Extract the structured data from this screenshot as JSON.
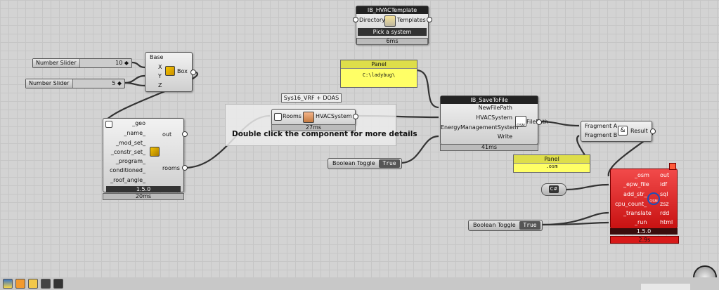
{
  "hvac_template": {
    "title": "IB_HVACTemplate",
    "in_directory": "Directory",
    "out_templates": "Templates",
    "pick": "Pick a system",
    "time": "6ms"
  },
  "panel1": {
    "title": "Panel",
    "text": "C:\\ladybug\\"
  },
  "slider1": {
    "name": "Number Slider",
    "value": "10 ◆"
  },
  "slider2": {
    "name": "Number Slider",
    "value": "5 ◆"
  },
  "box": {
    "base": "Base",
    "x": "X",
    "y": "Y",
    "z": "Z",
    "out": "Box"
  },
  "group": {
    "title": "Sys16_VRF + DOAS",
    "note": "Double click the component for more details",
    "in_rooms": "Rooms",
    "out_hvac": "HVACSystem",
    "time": "27ms"
  },
  "room": {
    "inputs": [
      "_geo",
      "_name_",
      "_mod_set_",
      "_constr_set_",
      "_program_",
      "conditioned_",
      "_roof_angle_"
    ],
    "out1": "out",
    "out2": "rooms",
    "version": "1.5.0",
    "time": "20ms"
  },
  "savefile": {
    "title": "IB_SaveToFile",
    "inputs": [
      "NewFilePath",
      "HVACSystem",
      "EnergyManagementSystem",
      "Write"
    ],
    "out": "FilePath",
    "icon": "OSM",
    "time": "41ms"
  },
  "toggle1": {
    "label": "Boolean Toggle",
    "value": "True"
  },
  "toggle2": {
    "label": "Boolean Toggle",
    "value": "True"
  },
  "panel2": {
    "title": "Panel",
    "text": ".osm"
  },
  "concat": {
    "in_a": "Fragment A",
    "in_b": "Fragment B",
    "out": "Result"
  },
  "cs_param": {
    "label": "C#"
  },
  "osm": {
    "inputs": [
      "_osm",
      "_epw_file",
      "add_str_",
      "cpu_count_",
      "_translate",
      "_run"
    ],
    "outputs": [
      "out",
      "idf",
      "sql",
      "zsz",
      "rdd",
      "html"
    ],
    "version": "1.5.0",
    "time": "2.9s",
    "icon": "OSM"
  },
  "colors": {
    "canvas": "#d3d3d3",
    "panel": "#ffff66",
    "error": "#e01b1b"
  }
}
